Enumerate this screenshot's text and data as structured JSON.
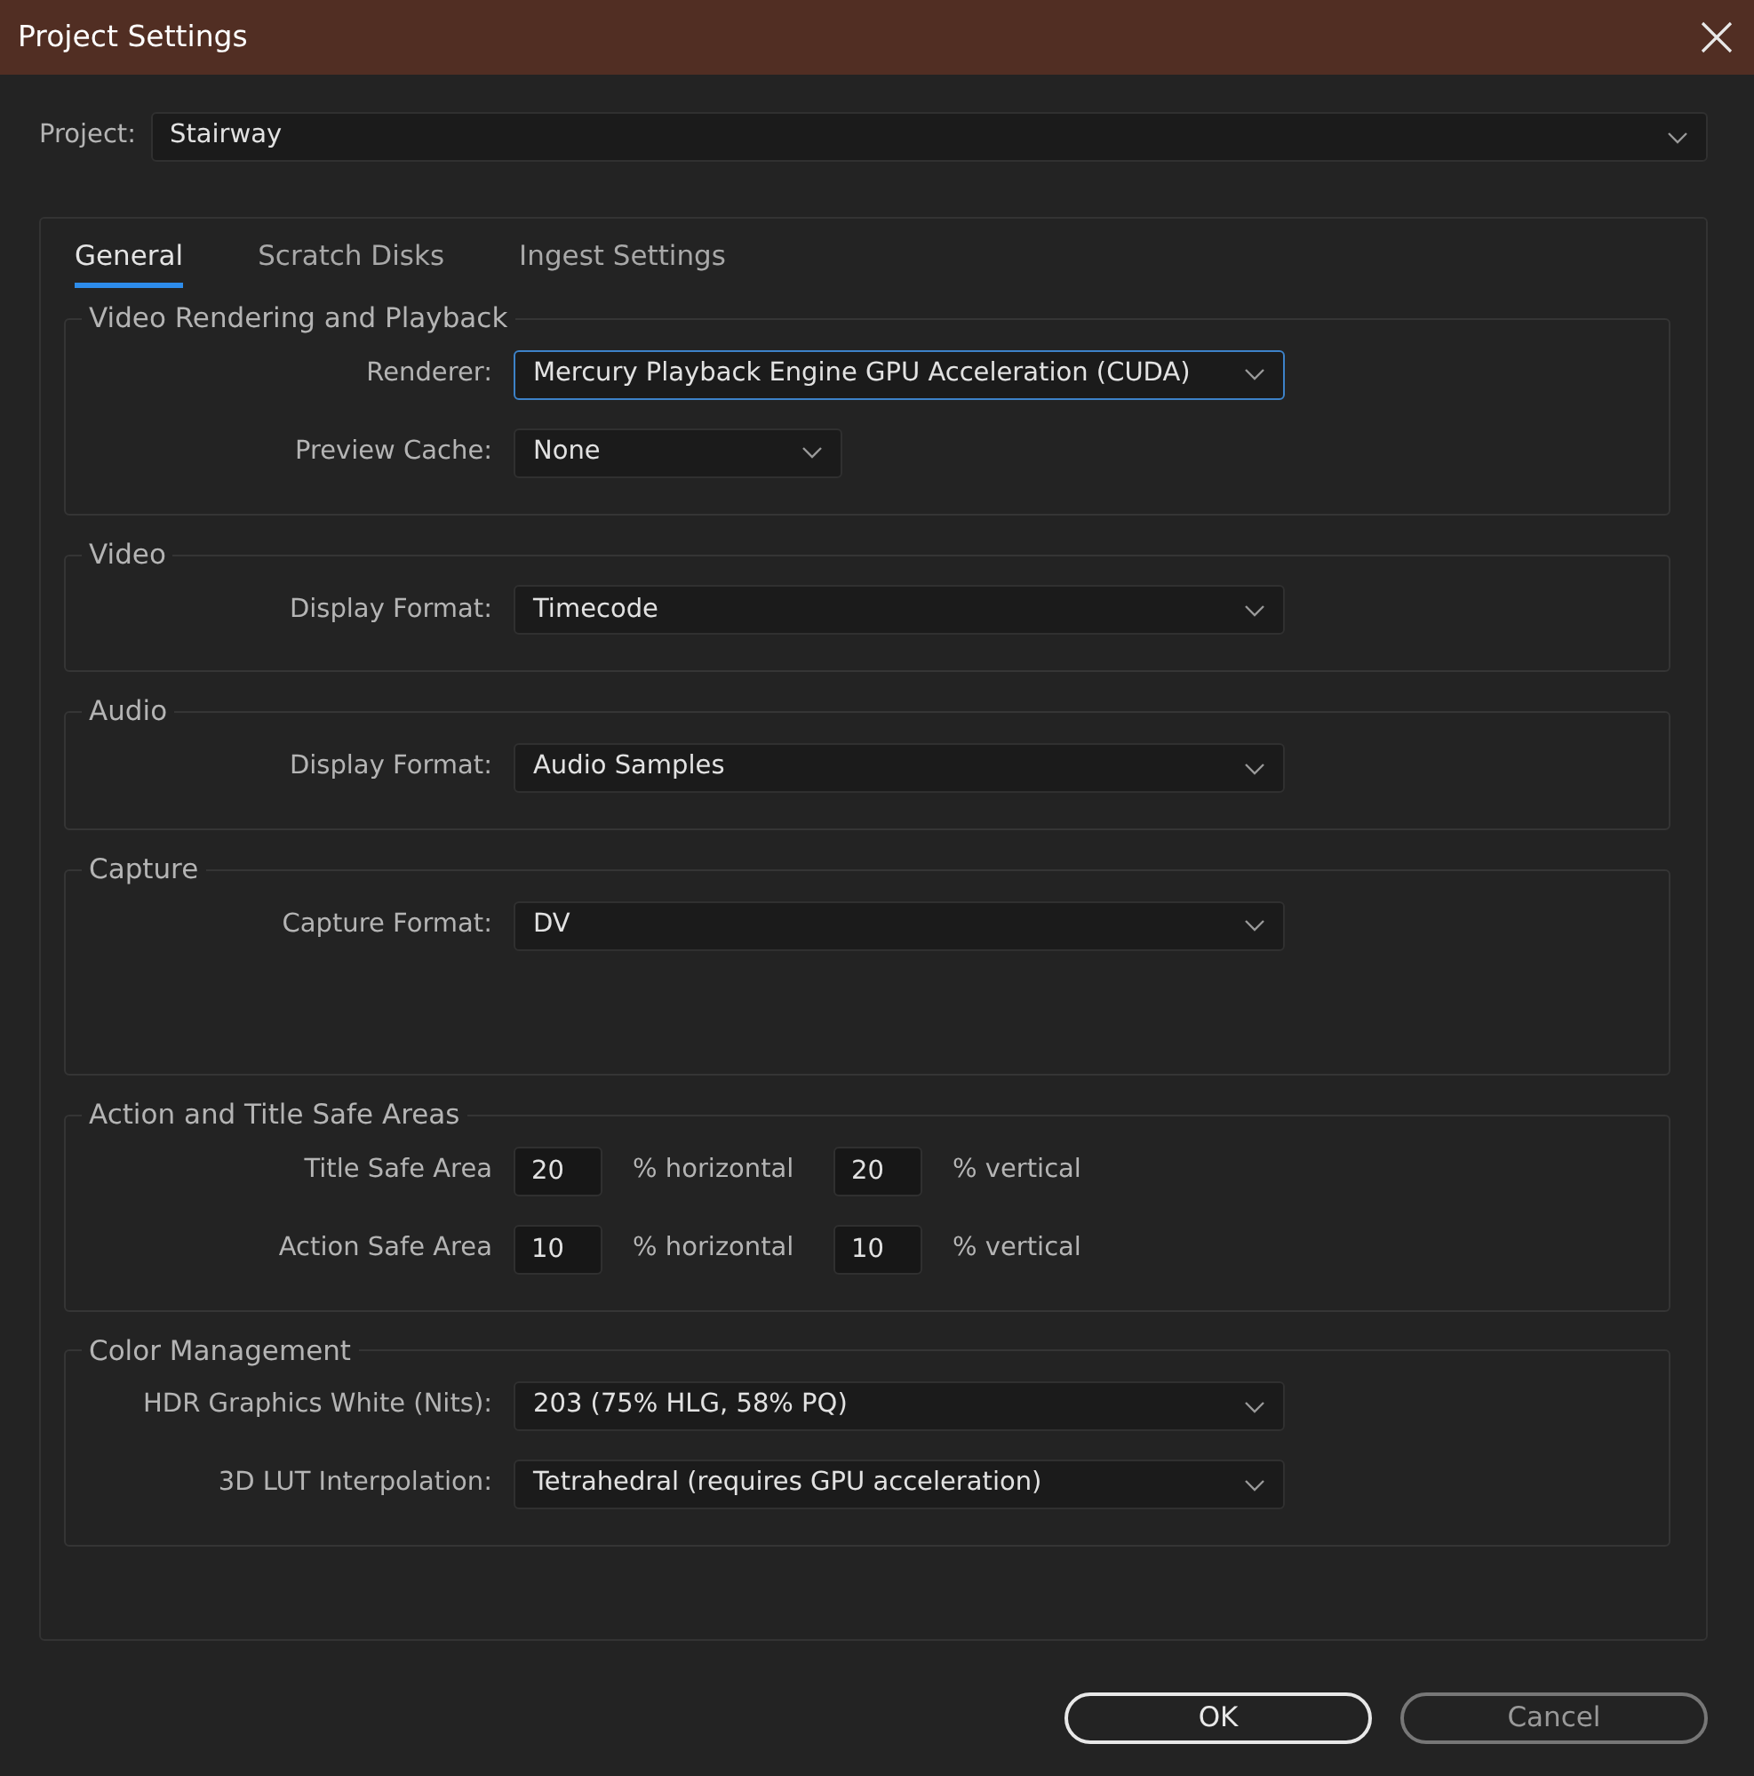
{
  "window": {
    "title": "Project Settings"
  },
  "project": {
    "label": "Project:",
    "value": "Stairway"
  },
  "tabs": [
    {
      "label": "General",
      "selected": true
    },
    {
      "label": "Scratch Disks",
      "selected": false
    },
    {
      "label": "Ingest Settings",
      "selected": false
    }
  ],
  "groups": [
    {
      "title": "Video Rendering and Playback",
      "rows": [
        {
          "kind": "select",
          "label": "Renderer:",
          "value": "Mercury Playback Engine GPU Acceleration (CUDA)",
          "focused": true
        },
        {
          "kind": "select",
          "label": "Preview Cache:",
          "value": "None",
          "focused": false
        }
      ]
    },
    {
      "title": "Video",
      "rows": [
        {
          "kind": "select",
          "label": "Display Format:",
          "value": "Timecode",
          "focused": false
        }
      ]
    },
    {
      "title": "Audio",
      "rows": [
        {
          "kind": "select",
          "label": "Display Format:",
          "value": "Audio Samples",
          "focused": false
        }
      ]
    },
    {
      "title": "Capture",
      "rows": [
        {
          "kind": "select",
          "label": "Capture Format:",
          "value": "DV",
          "focused": false
        }
      ]
    },
    {
      "title": "Action and Title Safe Areas",
      "rows": [
        {
          "kind": "safe",
          "label": "Title Safe Area",
          "fields": [
            {
              "value": "20",
              "unit": "% horizontal"
            },
            {
              "value": "20",
              "unit": "% vertical"
            }
          ]
        },
        {
          "kind": "safe",
          "label": "Action Safe Area",
          "fields": [
            {
              "value": "10",
              "unit": "% horizontal"
            },
            {
              "value": "10",
              "unit": "% vertical"
            }
          ]
        }
      ]
    },
    {
      "title": "Color Management",
      "rows": [
        {
          "kind": "select",
          "label": "HDR Graphics White (Nits):",
          "value": "203 (75% HLG, 58% PQ)",
          "focused": false
        },
        {
          "kind": "select",
          "label": "3D LUT Interpolation:",
          "value": "Tetrahedral (requires GPU acceleration)",
          "focused": false
        }
      ]
    }
  ],
  "buttons": [
    {
      "label": "OK",
      "kind": "default"
    },
    {
      "label": "Cancel",
      "kind": "secondary"
    }
  ]
}
